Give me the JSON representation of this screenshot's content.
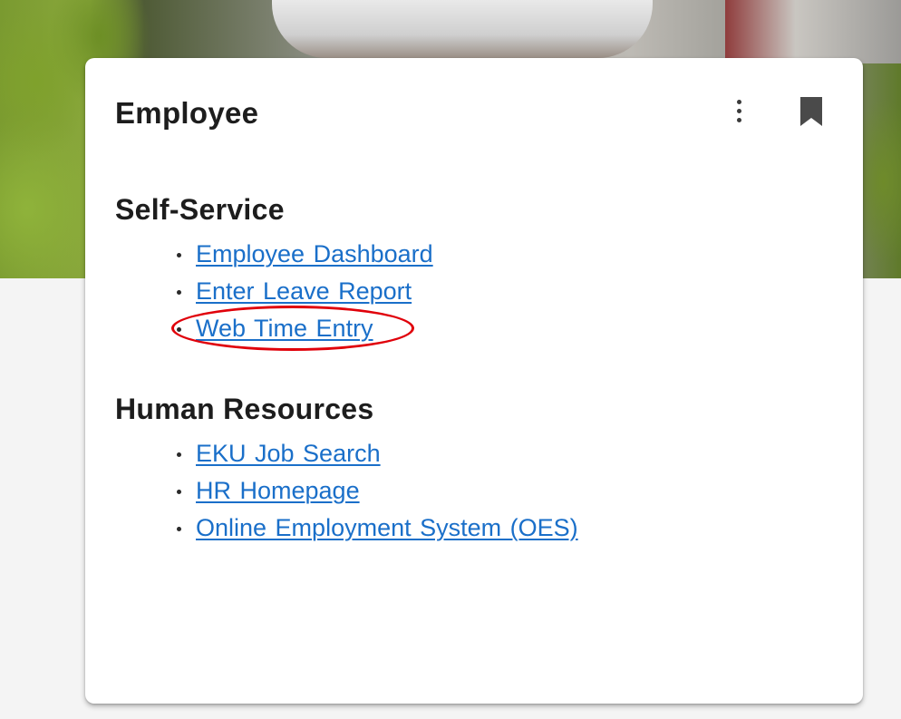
{
  "card": {
    "title": "Employee"
  },
  "sections": [
    {
      "heading": "Self-Service",
      "links": [
        {
          "label": "Employee Dashboard"
        },
        {
          "label": "Enter Leave Report"
        },
        {
          "label": "Web Time Entry",
          "highlighted": true
        }
      ]
    },
    {
      "heading": "Human Resources",
      "links": [
        {
          "label": "EKU Job Search"
        },
        {
          "label": "HR Homepage"
        },
        {
          "label": "Online Employment System (OES)"
        }
      ]
    }
  ],
  "icons": {
    "more": "more-vertical-icon",
    "bookmark": "bookmark-icon"
  },
  "colors": {
    "link": "#1a6fc9",
    "highlight": "#e0000a",
    "heading": "#1d1d1d"
  }
}
